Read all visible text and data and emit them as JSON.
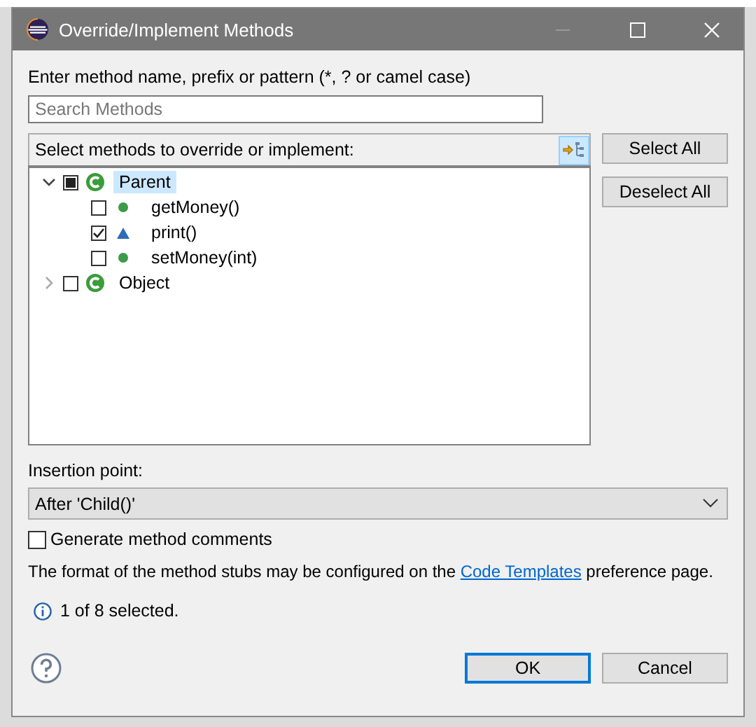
{
  "window": {
    "title": "Override/Implement Methods"
  },
  "filter": {
    "label": "Enter method name, prefix or pattern (*, ? or camel case)",
    "placeholder": "Search Methods"
  },
  "tree": {
    "header": "Select methods to override or implement:",
    "group_toggle_on": true,
    "items": [
      {
        "kind": "class",
        "label": "Parent",
        "expanded": true,
        "checked": false,
        "grayed": true,
        "selected": true,
        "children": [
          {
            "kind": "public",
            "label": "getMoney()",
            "checked": false,
            "selected": false
          },
          {
            "kind": "default",
            "label": "print()",
            "checked": true,
            "selected": false
          },
          {
            "kind": "public",
            "label": "setMoney(int)",
            "checked": false,
            "selected": false
          }
        ]
      },
      {
        "kind": "class",
        "label": "Object",
        "expanded": false,
        "checked": false,
        "grayed": false,
        "selected": false
      }
    ]
  },
  "side_buttons": [
    "Select All",
    "Deselect All"
  ],
  "insertion": {
    "label": "Insertion point:",
    "value": "After 'Child()'"
  },
  "generate_comments": {
    "label": "Generate method comments",
    "checked": false
  },
  "note": {
    "before": "The format of the method stubs may be configured on the ",
    "link": "Code Templates",
    "after": " preference page."
  },
  "status": "1 of 8 selected.",
  "buttons": [
    {
      "label": "OK",
      "default": true
    },
    {
      "label": "Cancel",
      "default": false
    }
  ]
}
